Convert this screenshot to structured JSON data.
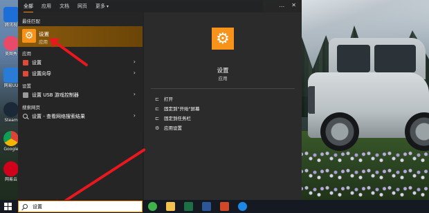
{
  "desktop": {
    "icons": [
      {
        "label": "腾讯视",
        "icon": "tencent-video-icon",
        "color": "#1e6ed8"
      },
      {
        "label": "美图秀",
        "icon": "meitu-icon",
        "color": "#e84a6a"
      },
      {
        "label": "网易UU",
        "icon": "uu-accelerator-icon",
        "color": "#2a7bd6"
      },
      {
        "label": "Steam",
        "icon": "steam-icon",
        "color": "#1b2838"
      },
      {
        "label": "Google",
        "icon": "chrome-icon",
        "color": "#e6e6e6"
      },
      {
        "label": "网易云",
        "icon": "netease-music-icon",
        "color": "#d0021b"
      }
    ]
  },
  "start_menu": {
    "tabs": [
      {
        "label": "全部",
        "active": true
      },
      {
        "label": "应用"
      },
      {
        "label": "文档"
      },
      {
        "label": "网页"
      },
      {
        "label": "更多"
      }
    ],
    "tabs_right": {
      "more": "…",
      "close": "✕"
    },
    "sections": {
      "best_match": "最佳匹配",
      "apps": "应用",
      "settings": "设置",
      "web": "搜索网页"
    },
    "best_match_item": {
      "title": "设置",
      "subtitle": "应用"
    },
    "app_items": [
      {
        "label": "设置",
        "icon_color": "#e0493a"
      },
      {
        "label": "设置向导",
        "icon_color": "#e0493a"
      }
    ],
    "settings_items": [
      {
        "label": "设置 USB 游戏控制器"
      }
    ],
    "web_items": [
      {
        "label": "设置 - 查看网络搜索结果"
      }
    ],
    "preview": {
      "title": "设置",
      "subtitle": "应用",
      "actions": [
        {
          "label": "打开",
          "icon": "open-icon"
        },
        {
          "label": "固定到\"开始\"屏幕",
          "icon": "pin-start-icon"
        },
        {
          "label": "固定到任务栏",
          "icon": "pin-taskbar-icon"
        },
        {
          "label": "应用设置",
          "icon": "app-settings-icon"
        }
      ]
    }
  },
  "taskbar": {
    "search_value": "设置",
    "apps": [
      {
        "name": "wechat-icon",
        "color": "#3fb24b"
      },
      {
        "name": "file-explorer-icon",
        "color": "#f2c14e"
      },
      {
        "name": "excel-icon",
        "color": "#1d7044"
      },
      {
        "name": "word-icon",
        "color": "#2b5797"
      },
      {
        "name": "powerpoint-icon",
        "color": "#d24726"
      },
      {
        "name": "download-icon",
        "color": "#1e88e5"
      }
    ]
  },
  "colors": {
    "accent": "#ff8c00",
    "gear_tile": "#f7931a",
    "arrow": "#e8181e"
  }
}
